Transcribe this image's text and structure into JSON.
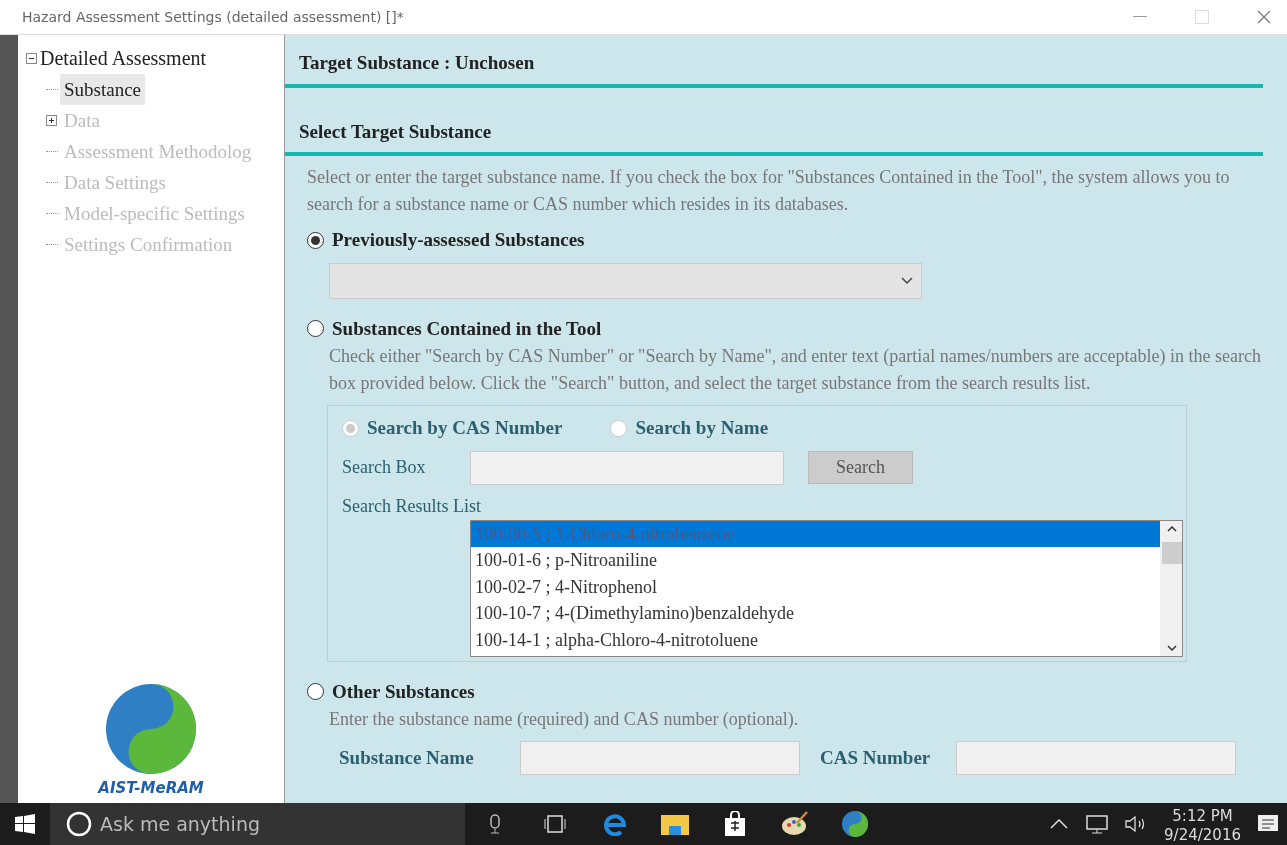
{
  "window": {
    "title": "Hazard Assessment Settings (detailed assessment) []*"
  },
  "tree": {
    "label": "Detailed Assessment",
    "expanded": true,
    "children": [
      {
        "label": "Substance",
        "selected": true,
        "disabled": false
      },
      {
        "label": "Data",
        "selected": false,
        "disabled": true,
        "expanded": false
      },
      {
        "label": "Assessment Methodolog",
        "selected": false,
        "disabled": true
      },
      {
        "label": "Data Settings",
        "selected": false,
        "disabled": true
      },
      {
        "label": "Model-specific Settings",
        "selected": false,
        "disabled": true
      },
      {
        "label": "Settings Confirmation",
        "selected": false,
        "disabled": true
      }
    ]
  },
  "logo": {
    "text": "AIST-MeRAM"
  },
  "target_header": "Target Substance : Unchosen",
  "section_title": "Select Target Substance",
  "intro": "Select or enter the target substance name. If you check the box for \"Substances Contained in the Tool\", the system allows you to search for a substance name or CAS number which resides in its databases.",
  "options": [
    {
      "kind": "dropdown",
      "label": "Previously-assessed Substances",
      "selected": true
    },
    {
      "kind": "search",
      "label": "Substances Contained in the Tool",
      "selected": false,
      "description": "Check either \"Search by CAS Number\" or \"Search by Name\", and enter text (partial names/numbers are acceptable) in the search box provided below. Click the \"Search\" button, and select the target substance from the search results list.",
      "search_modes": [
        {
          "label": "Search by CAS Number",
          "selected": true,
          "disabled": true
        },
        {
          "label": "Search by Name",
          "selected": false,
          "disabled": true
        }
      ],
      "search_box_label": "Search Box",
      "search_button": "Search",
      "results_label": "Search Results List",
      "results": [
        {
          "text": "100-00-5 ; 1-Chloro-4-nitrobenzene",
          "selected": true
        },
        {
          "text": "100-01-6 ; p-Nitroaniline",
          "selected": false
        },
        {
          "text": "100-02-7 ; 4-Nitrophenol",
          "selected": false
        },
        {
          "text": "100-10-7 ; 4-(Dimethylamino)benzaldehyde",
          "selected": false
        },
        {
          "text": "100-14-1 ; alpha-Chloro-4-nitrotoluene",
          "selected": false
        }
      ]
    },
    {
      "kind": "manual",
      "label": "Other Substances",
      "selected": false,
      "description": "Enter the substance name (required) and CAS number (optional).",
      "fields": [
        {
          "label": "Substance Name"
        },
        {
          "label": "CAS Number"
        }
      ]
    }
  ],
  "taskbar": {
    "search_placeholder": "Ask me anything",
    "time": "5:12 PM",
    "date": "9/24/2016"
  }
}
